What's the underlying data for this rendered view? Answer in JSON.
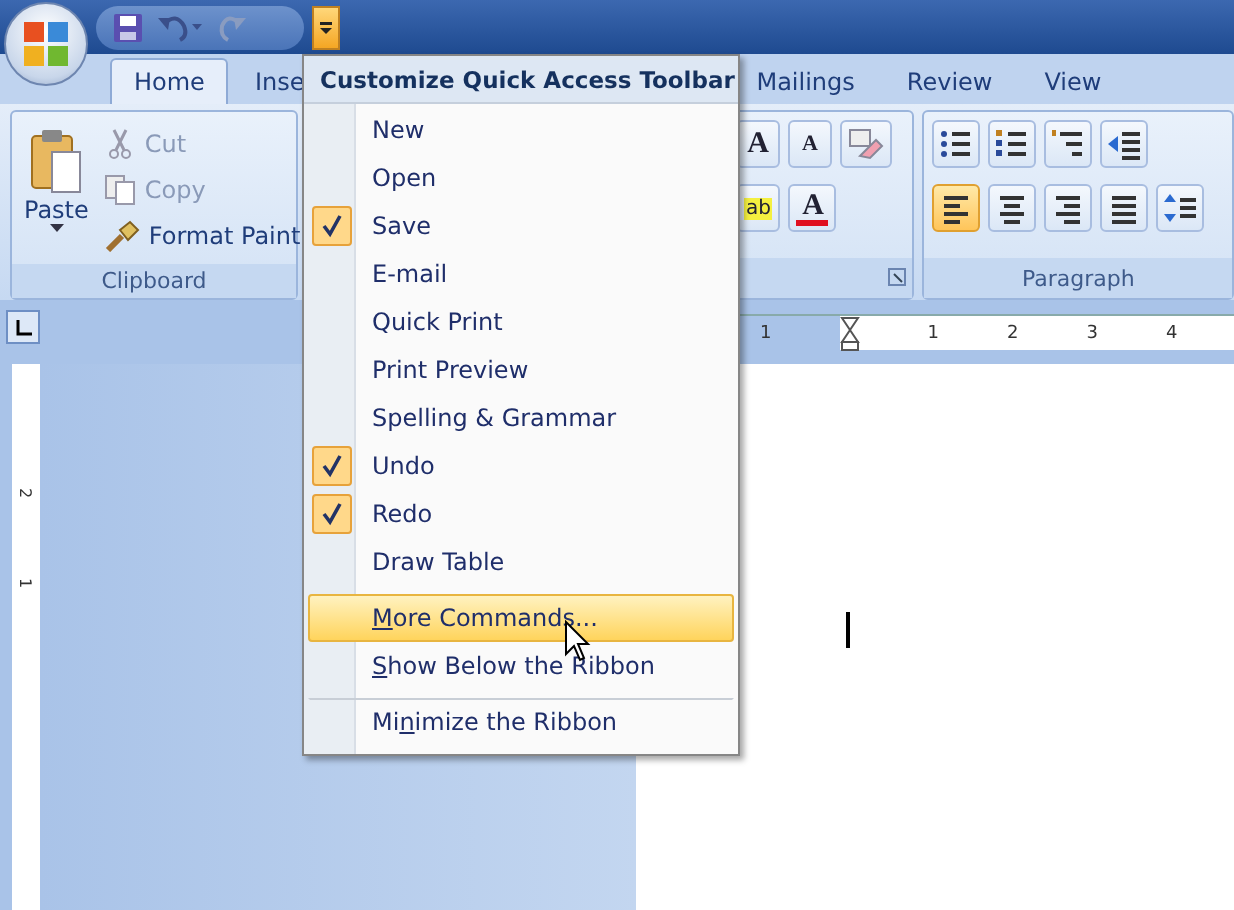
{
  "quick_access": {
    "items": [
      {
        "kind": "save",
        "disabled": false
      },
      {
        "kind": "undo",
        "disabled": false
      },
      {
        "kind": "redo",
        "disabled": true
      }
    ],
    "customize_open": true
  },
  "tabs": [
    {
      "label": "Home",
      "selected": true
    },
    {
      "label": "Inse",
      "selected": false
    },
    {
      "label": "Mailings",
      "selected": false
    },
    {
      "label": "Review",
      "selected": false
    },
    {
      "label": "View",
      "selected": false
    }
  ],
  "clipboard": {
    "paste": "Paste",
    "actions": [
      {
        "kind": "cut",
        "label": "Cut",
        "disabled": true
      },
      {
        "kind": "copy",
        "label": "Copy",
        "disabled": true
      },
      {
        "kind": "brush",
        "label": "Format Paint",
        "disabled": false
      }
    ],
    "title": "Clipboard"
  },
  "font_group": {
    "row1": [
      {
        "kind": "grow",
        "glyph": "A"
      },
      {
        "kind": "shrink",
        "glyph": "A"
      },
      {
        "kind": "clear"
      }
    ],
    "row2": [
      {
        "kind": "highlight",
        "glyph": "ab"
      },
      {
        "kind": "color",
        "glyph": "A",
        "color": "#e01020"
      }
    ]
  },
  "paragraph": {
    "row1": [
      {
        "kind": "bullets"
      },
      {
        "kind": "numbering"
      },
      {
        "kind": "multilevel"
      },
      {
        "kind": "indent"
      }
    ],
    "row2": [
      {
        "kind": "left",
        "selected": true
      },
      {
        "kind": "center",
        "selected": false
      },
      {
        "kind": "right",
        "selected": false
      },
      {
        "kind": "justify",
        "selected": false
      },
      {
        "kind": "spacing",
        "selected": false
      }
    ],
    "title": "Paragraph"
  },
  "ruler": {
    "numbers": [
      "1",
      "1",
      "2",
      "3",
      "4"
    ]
  },
  "vertical_ruler": {
    "numbers": [
      "2",
      "1"
    ]
  },
  "menu": {
    "title": "Customize Quick Access Toolbar",
    "items": [
      {
        "label": "New",
        "checked": false,
        "highlighted": false,
        "separator_before": false
      },
      {
        "label": "Open",
        "checked": false,
        "highlighted": false,
        "separator_before": false
      },
      {
        "label": "Save",
        "checked": true,
        "highlighted": false,
        "separator_before": false
      },
      {
        "label": "E-mail",
        "checked": false,
        "highlighted": false,
        "separator_before": false
      },
      {
        "label": "Quick Print",
        "checked": false,
        "highlighted": false,
        "separator_before": false
      },
      {
        "label": "Print Preview",
        "checked": false,
        "highlighted": false,
        "separator_before": false
      },
      {
        "label": "Spelling & Grammar",
        "checked": false,
        "highlighted": false,
        "separator_before": false
      },
      {
        "label": "Undo",
        "checked": true,
        "highlighted": false,
        "separator_before": false
      },
      {
        "label": "Redo",
        "checked": true,
        "highlighted": false,
        "separator_before": false
      },
      {
        "label": "Draw Table",
        "checked": false,
        "highlighted": false,
        "separator_before": false
      },
      {
        "label": {
          "key": "M",
          "after": "ore Commands..."
        },
        "checked": false,
        "highlighted": true,
        "separator_before": true
      },
      {
        "label": {
          "key": "S",
          "after": "how Below the Ribbon"
        },
        "checked": false,
        "highlighted": false,
        "separator_before": false
      },
      {
        "label": {
          "before": "Mi",
          "key": "n",
          "after": "imize the Ribbon"
        },
        "checked": false,
        "highlighted": false,
        "separator_before": true
      }
    ]
  }
}
